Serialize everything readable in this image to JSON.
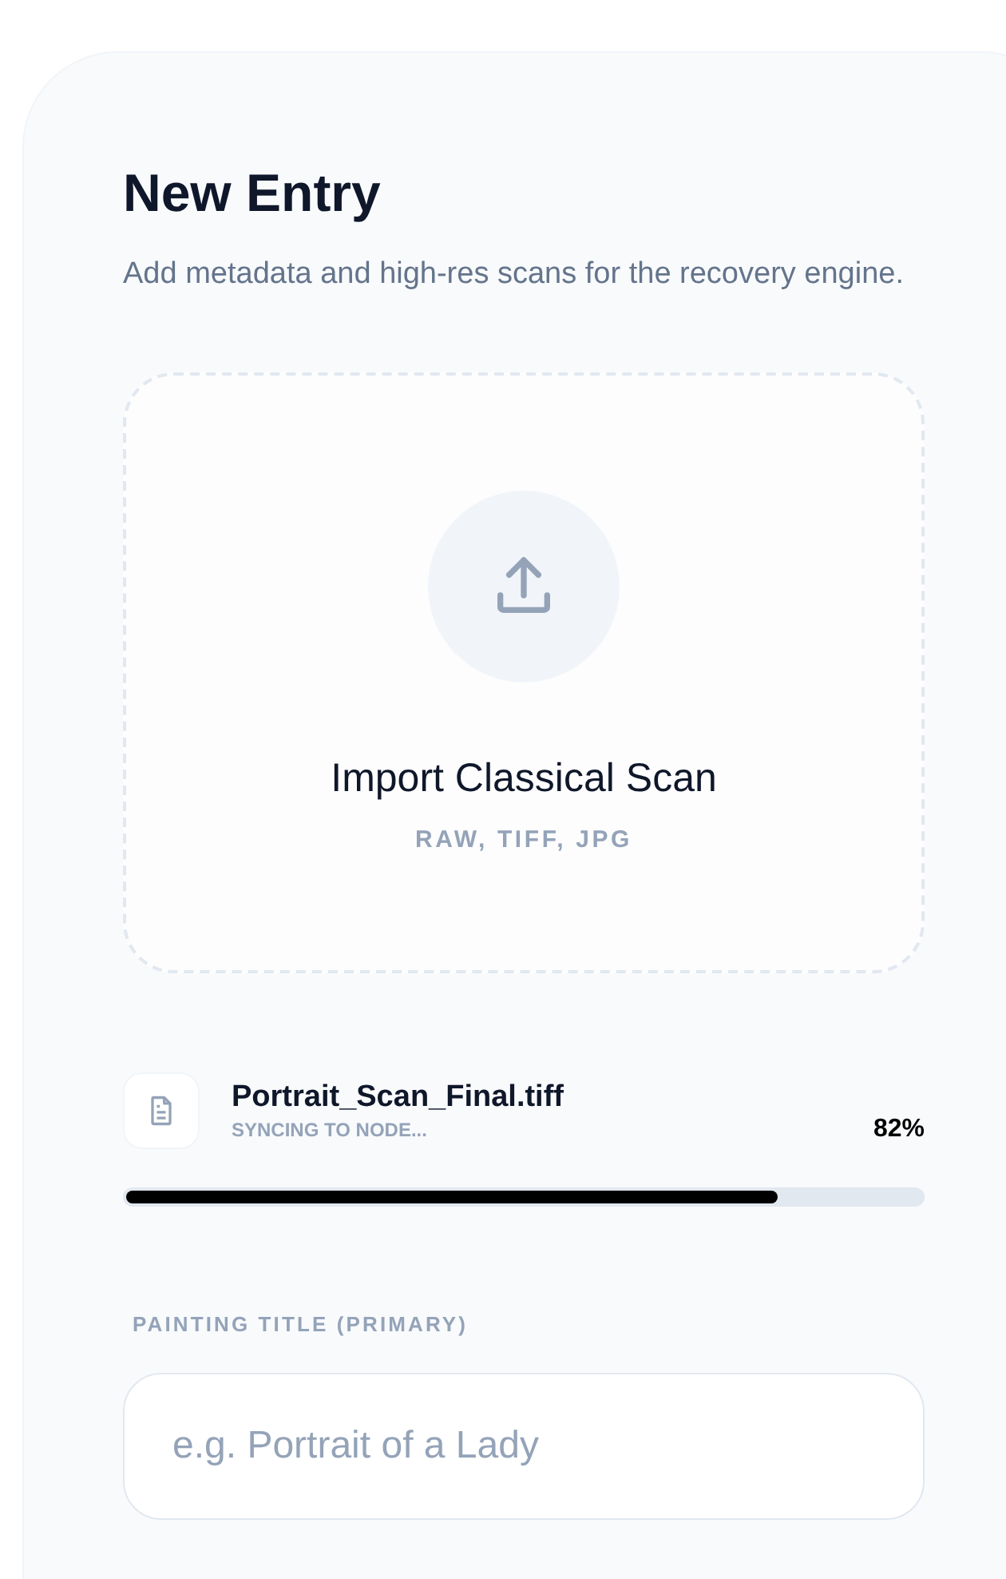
{
  "header": {
    "title": "New Entry",
    "subtitle": "Add metadata and high-res scans for the recovery engine."
  },
  "dropzone": {
    "title": "Import Classical Scan",
    "formats": "RAW, TIFF, JPG"
  },
  "upload": {
    "filename": "Portrait_Scan_Final.tiff",
    "status": "SYNCING TO NODE...",
    "percent": "82%",
    "level": 0.82
  },
  "fields": [
    {
      "label": "PAINTING TITLE (PRIMARY)",
      "placeholder": "e.g. Portrait of a Lady"
    }
  ]
}
